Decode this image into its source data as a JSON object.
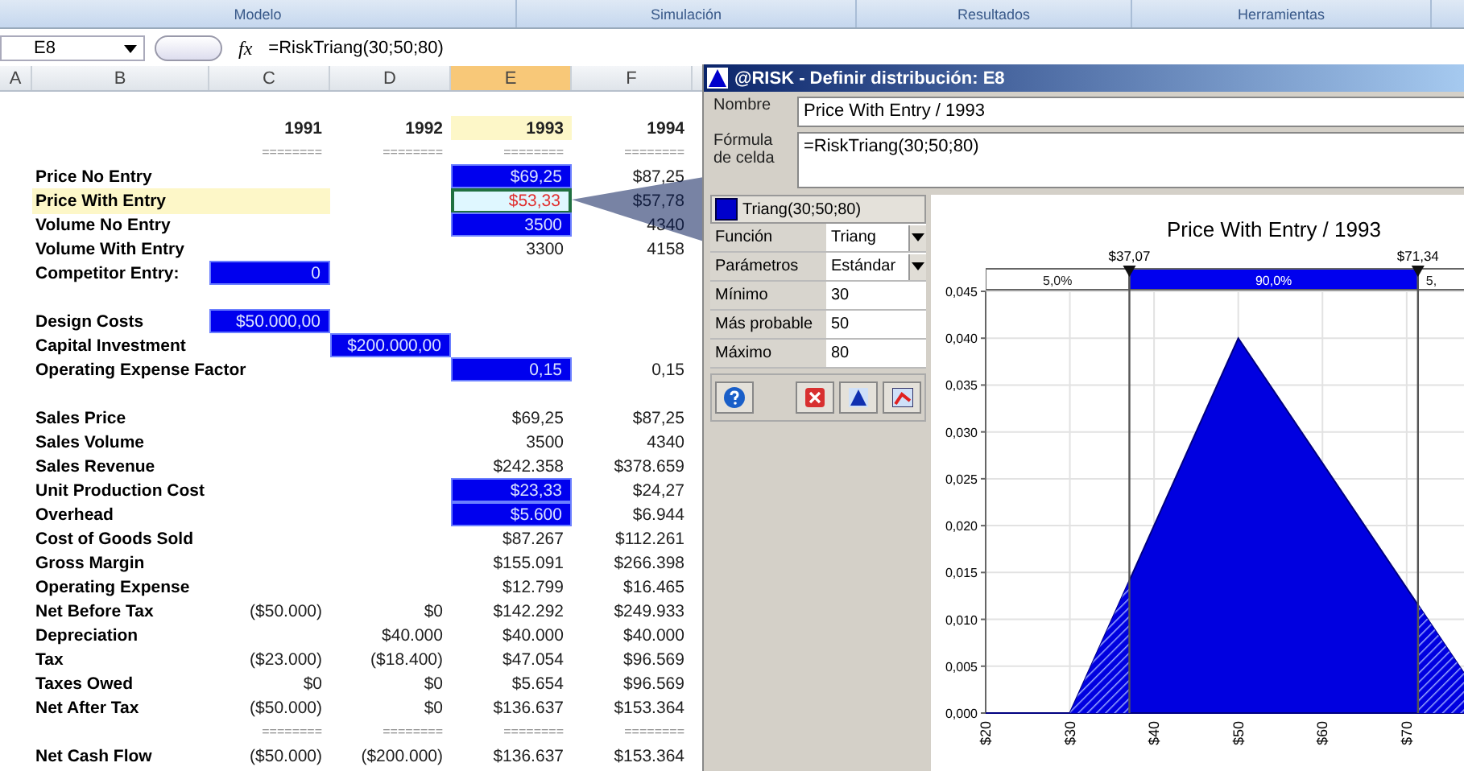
{
  "ribbon": {
    "groups": [
      "Modelo",
      "Simulación",
      "Resultados",
      "Herramientas"
    ]
  },
  "formula_bar": {
    "cell": "E8",
    "function_label": "fx",
    "formula": "=RiskTriang(30;50;80)"
  },
  "sheet": {
    "columns": [
      {
        "label": "A",
        "selected": false
      },
      {
        "label": "B",
        "selected": false
      },
      {
        "label": "C",
        "selected": false
      },
      {
        "label": "D",
        "selected": false
      },
      {
        "label": "E",
        "selected": true
      },
      {
        "label": "F",
        "selected": false
      }
    ],
    "rows": [
      {
        "kind": "blank"
      },
      {
        "kind": "heading",
        "cells": [
          {
            "text": "1991",
            "kind": "plain"
          },
          {
            "text": "1992",
            "kind": "plain"
          },
          {
            "text": "1993",
            "kind": "highlight"
          },
          {
            "text": "1994",
            "kind": "plain"
          }
        ]
      },
      {
        "kind": "separator",
        "cells": [
          {
            "text": "========",
            "kind": "plain"
          },
          {
            "text": "========",
            "kind": "plain"
          },
          {
            "text": "========",
            "kind": "plain"
          },
          {
            "text": "========",
            "kind": "plain"
          }
        ]
      },
      {
        "kind": "data",
        "label": "Price No Entry",
        "label_selected": false,
        "cells": [
          null,
          null,
          {
            "text": "$69,25",
            "kind": "input"
          },
          {
            "text": "$87,25",
            "kind": "plain"
          }
        ]
      },
      {
        "kind": "data",
        "label": "Price With Entry",
        "label_selected": true,
        "cells": [
          null,
          null,
          {
            "text": "$53,33",
            "kind": "selected"
          },
          {
            "text": "$57,78",
            "kind": "plain"
          }
        ]
      },
      {
        "kind": "data",
        "label": "Volume No Entry",
        "label_selected": false,
        "cells": [
          null,
          null,
          {
            "text": "3500",
            "kind": "input"
          },
          {
            "text": "4340",
            "kind": "plain"
          }
        ]
      },
      {
        "kind": "data",
        "label": "Volume With Entry",
        "label_selected": false,
        "cells": [
          null,
          null,
          {
            "text": "3300",
            "kind": "plain"
          },
          {
            "text": "4158",
            "kind": "plain"
          }
        ]
      },
      {
        "kind": "data",
        "label": "Competitor Entry:",
        "label_selected": false,
        "cells": [
          {
            "text": "0",
            "kind": "input"
          },
          null,
          null,
          null
        ]
      },
      {
        "kind": "blank"
      },
      {
        "kind": "data",
        "label": "Design Costs",
        "label_selected": false,
        "cells": [
          {
            "text": "$50.000,00",
            "kind": "input"
          },
          null,
          null,
          null
        ]
      },
      {
        "kind": "data",
        "label": "Capital Investment",
        "label_selected": false,
        "cells": [
          null,
          {
            "text": "$200.000,00",
            "kind": "input"
          },
          null,
          null
        ]
      },
      {
        "kind": "data",
        "label": "Operating Expense Factor",
        "label_selected": false,
        "cells": [
          null,
          null,
          {
            "text": "0,15",
            "kind": "input"
          },
          {
            "text": "0,15",
            "kind": "plain"
          }
        ]
      },
      {
        "kind": "blank"
      },
      {
        "kind": "data",
        "label": "Sales Price",
        "label_selected": false,
        "cells": [
          null,
          null,
          {
            "text": "$69,25",
            "kind": "plain"
          },
          {
            "text": "$87,25",
            "kind": "plain"
          }
        ]
      },
      {
        "kind": "data",
        "label": "Sales Volume",
        "label_selected": false,
        "cells": [
          null,
          null,
          {
            "text": "3500",
            "kind": "plain"
          },
          {
            "text": "4340",
            "kind": "plain"
          }
        ]
      },
      {
        "kind": "data",
        "label": "Sales Revenue",
        "label_selected": false,
        "cells": [
          null,
          null,
          {
            "text": "$242.358",
            "kind": "plain"
          },
          {
            "text": "$378.659",
            "kind": "plain"
          }
        ]
      },
      {
        "kind": "data",
        "label": "Unit Production Cost",
        "label_selected": false,
        "cells": [
          null,
          null,
          {
            "text": "$23,33",
            "kind": "input"
          },
          {
            "text": "$24,27",
            "kind": "plain"
          }
        ]
      },
      {
        "kind": "data",
        "label": "Overhead",
        "label_selected": false,
        "cells": [
          null,
          null,
          {
            "text": "$5.600",
            "kind": "input"
          },
          {
            "text": "$6.944",
            "kind": "plain"
          }
        ]
      },
      {
        "kind": "data",
        "label": "Cost of Goods Sold",
        "label_selected": false,
        "cells": [
          null,
          null,
          {
            "text": "$87.267",
            "kind": "plain"
          },
          {
            "text": "$112.261",
            "kind": "plain"
          }
        ]
      },
      {
        "kind": "data",
        "label": "Gross Margin",
        "label_selected": false,
        "cells": [
          null,
          null,
          {
            "text": "$155.091",
            "kind": "plain"
          },
          {
            "text": "$266.398",
            "kind": "plain"
          }
        ]
      },
      {
        "kind": "data",
        "label": "Operating Expense",
        "label_selected": false,
        "cells": [
          null,
          null,
          {
            "text": "$12.799",
            "kind": "plain"
          },
          {
            "text": "$16.465",
            "kind": "plain"
          }
        ]
      },
      {
        "kind": "data",
        "label": "Net Before Tax",
        "label_selected": false,
        "cells": [
          {
            "text": "($50.000)",
            "kind": "plain"
          },
          {
            "text": "$0",
            "kind": "plain"
          },
          {
            "text": "$142.292",
            "kind": "plain"
          },
          {
            "text": "$249.933",
            "kind": "plain"
          }
        ]
      },
      {
        "kind": "data",
        "label": "Depreciation",
        "label_selected": false,
        "cells": [
          null,
          {
            "text": "$40.000",
            "kind": "plain"
          },
          {
            "text": "$40.000",
            "kind": "plain"
          },
          {
            "text": "$40.000",
            "kind": "plain"
          }
        ]
      },
      {
        "kind": "data",
        "label": "Tax",
        "label_selected": false,
        "cells": [
          {
            "text": "($23.000)",
            "kind": "plain"
          },
          {
            "text": "($18.400)",
            "kind": "plain"
          },
          {
            "text": "$47.054",
            "kind": "plain"
          },
          {
            "text": "$96.569",
            "kind": "plain"
          }
        ]
      },
      {
        "kind": "data",
        "label": "Taxes Owed",
        "label_selected": false,
        "cells": [
          {
            "text": "$0",
            "kind": "plain"
          },
          {
            "text": "$0",
            "kind": "plain"
          },
          {
            "text": "$5.654",
            "kind": "plain"
          },
          {
            "text": "$96.569",
            "kind": "plain"
          }
        ]
      },
      {
        "kind": "data",
        "label": "Net After Tax",
        "label_selected": false,
        "cells": [
          {
            "text": "($50.000)",
            "kind": "plain"
          },
          {
            "text": "$0",
            "kind": "plain"
          },
          {
            "text": "$136.637",
            "kind": "plain"
          },
          {
            "text": "$153.364",
            "kind": "plain"
          }
        ]
      },
      {
        "kind": "separator",
        "cells": [
          {
            "text": "========",
            "kind": "plain"
          },
          {
            "text": "========",
            "kind": "plain"
          },
          {
            "text": "========",
            "kind": "plain"
          },
          {
            "text": "========",
            "kind": "plain"
          }
        ]
      },
      {
        "kind": "data",
        "label": "Net Cash Flow",
        "label_selected": false,
        "cells": [
          {
            "text": "($50.000)",
            "kind": "plain"
          },
          {
            "text": "($200.000)",
            "kind": "plain"
          },
          {
            "text": "$136.637",
            "kind": "plain"
          },
          {
            "text": "$153.364",
            "kind": "plain"
          }
        ]
      }
    ]
  },
  "dialog": {
    "title": "@RISK - Definir distribución: E8",
    "name_label": "Nombre",
    "name_value": "Price With Entry / 1993",
    "formula_label": "Fórmula de celda",
    "formula_value": "=RiskTriang(30;50;80)",
    "distribution": {
      "label": "Triang(30;50;80)",
      "fields": [
        {
          "label": "Función",
          "value": "Triang",
          "kind": "dropdown"
        },
        {
          "label": "Parámetros",
          "value": "Estándar",
          "kind": "dropdown"
        },
        {
          "label": "Mínimo",
          "value": "30",
          "kind": "input"
        },
        {
          "label": "Más probable",
          "value": "50",
          "kind": "input"
        },
        {
          "label": "Máximo",
          "value": "80",
          "kind": "input"
        }
      ]
    },
    "chart": {
      "percentile_bar": [
        {
          "label": "5,0%",
          "selected": false
        },
        {
          "label": "90,0%",
          "selected": true
        },
        {
          "label": "5,",
          "selected": false
        }
      ],
      "chart_data": {
        "type": "area",
        "title": "Price With Entry / 1993",
        "grid": true,
        "x": [
          20,
          30,
          50,
          77
        ],
        "series": [
          {
            "color": "#0000e0",
            "values": [
              0,
              0,
              0.04,
              0.004
            ]
          }
        ],
        "xlim": [
          20,
          77
        ],
        "ylim": [
          0,
          0.045
        ],
        "xticks": [
          {
            "value": 20,
            "label": "$20"
          },
          {
            "value": 30,
            "label": "$30"
          },
          {
            "value": 40,
            "label": "$40"
          },
          {
            "value": 50,
            "label": "$50"
          },
          {
            "value": 60,
            "label": "$60"
          },
          {
            "value": 70,
            "label": "$70"
          }
        ],
        "yticks": [
          {
            "value": 0,
            "label": "0,000"
          },
          {
            "value": 0.005,
            "label": "0,005"
          },
          {
            "value": 0.01,
            "label": "0,010"
          },
          {
            "value": 0.015,
            "label": "0,015"
          },
          {
            "value": 0.02,
            "label": "0,020"
          },
          {
            "value": 0.025,
            "label": "0,025"
          },
          {
            "value": 0.03,
            "label": "0,030"
          },
          {
            "value": 0.035,
            "label": "0,035"
          },
          {
            "value": 0.04,
            "label": "0,040"
          },
          {
            "value": 0.045,
            "label": "0,045"
          }
        ],
        "ref_lines": [
          {
            "axis": "x",
            "value": 37.07,
            "label": "$37,07"
          },
          {
            "axis": "x",
            "value": 71.34,
            "label": "$71,34"
          }
        ]
      }
    }
  }
}
